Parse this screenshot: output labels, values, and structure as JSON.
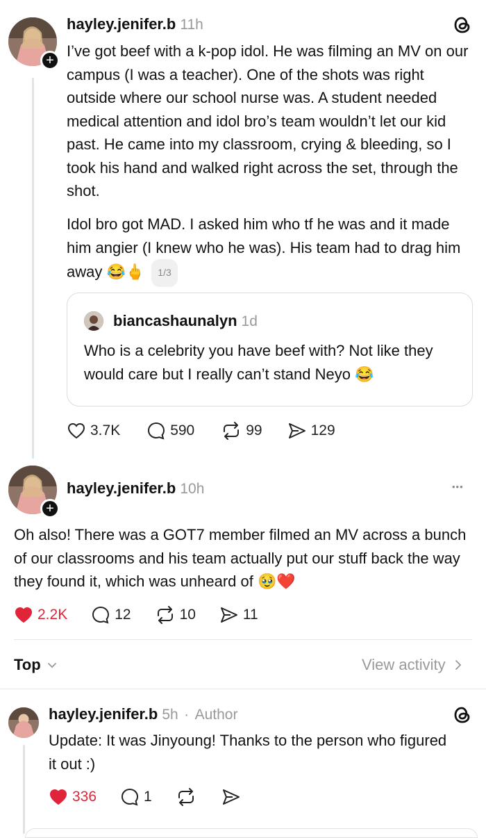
{
  "post1": {
    "username": "hayley.jenifer.b",
    "time": "11h",
    "paragraph1": "I’ve got beef with a k-pop idol. He was filming an MV on our campus (I was a teacher). One of the shots was right outside where our school nurse was. A student needed medical attention and idol bro’s team wouldn’t let our kid past. He came into my classroom, crying & bleeding, so I took his hand and walked right across the set, through the shot.",
    "paragraph2": "Idol bro got MAD. I asked him who tf he was and it made him angier (I knew who he was). His team had to drag him away",
    "emoji": "😂🖕",
    "page_badge": "1/3",
    "quote": {
      "username": "biancashaunalyn",
      "time": "1d",
      "text": "Who is a celebrity you have beef with? Not like they would care but I really can’t stand Neyo",
      "emoji": "😂"
    },
    "likes": "3.7K",
    "replies": "590",
    "reposts": "99",
    "shares": "129"
  },
  "post2": {
    "username": "hayley.jenifer.b",
    "time": "10h",
    "more": "•••",
    "text": "Oh also! There was a GOT7 member filmed an MV across a bunch of our classrooms and his team actually put our stuff back the way they found it, which was unheard of",
    "emoji": "🥹❤️",
    "likes": "2.2K",
    "replies": "12",
    "reposts": "10",
    "shares": "11"
  },
  "sort": {
    "label": "Top",
    "view_activity": "View activity"
  },
  "reply1": {
    "username": "hayley.jenifer.b",
    "time": "5h",
    "separator": "·",
    "author_label": "Author",
    "text": "Update: It was Jinyoung! Thanks to the person who figured it out :)",
    "likes": "336",
    "replies": "1"
  },
  "colors": {
    "liked_red": "#e0243a",
    "muted": "#999999",
    "divider": "#e5e5e5"
  },
  "icons": [
    "threads-logo-icon",
    "plus-icon",
    "heart-icon",
    "comment-icon",
    "repost-icon",
    "share-icon",
    "more-icon",
    "chevron-down-icon",
    "chevron-right-icon"
  ]
}
